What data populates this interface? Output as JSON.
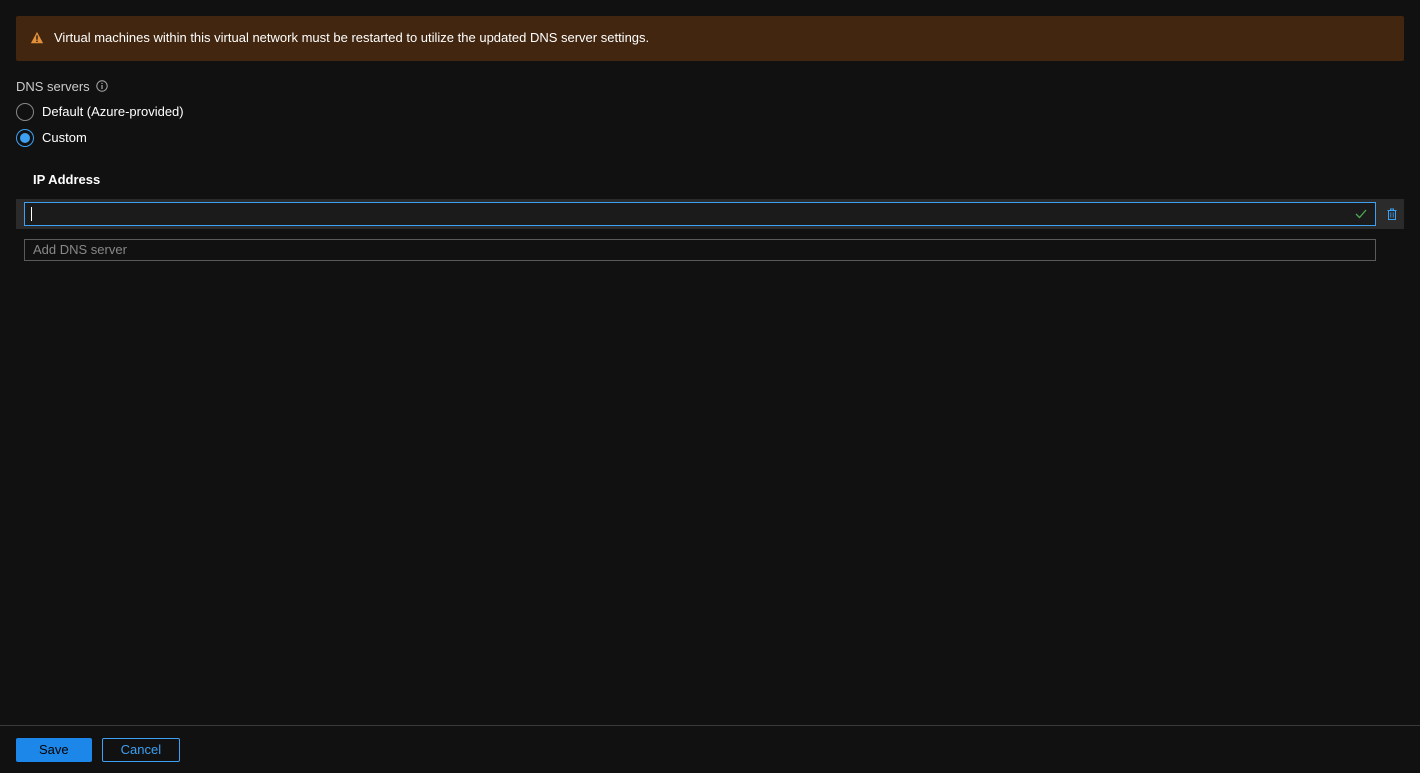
{
  "warning": {
    "message": "Virtual machines within this virtual network must be restarted to utilize the updated DNS server settings."
  },
  "dns_servers_section": {
    "label": "DNS servers",
    "options": {
      "default": "Default (Azure-provided)",
      "custom": "Custom"
    },
    "selected": "custom"
  },
  "ip_section": {
    "header": "IP Address",
    "current_value": "",
    "add_placeholder": "Add DNS server"
  },
  "footer": {
    "save_label": "Save",
    "cancel_label": "Cancel"
  }
}
